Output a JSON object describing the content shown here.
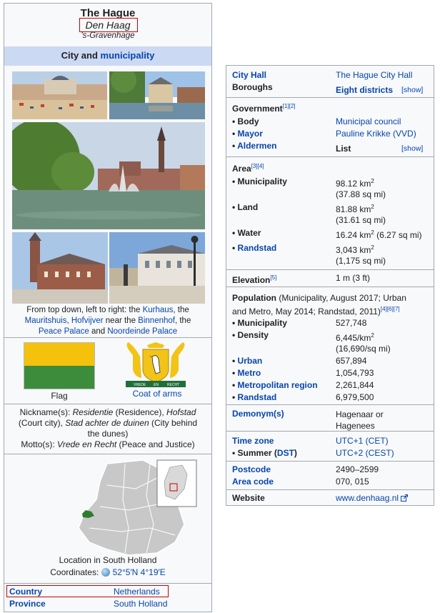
{
  "left": {
    "title": "The Hague",
    "native_name": "Den Haag",
    "other_name": "'s-Gravenhage",
    "header_plain": "City and ",
    "header_link": "municipality",
    "caption_parts": [
      "From top down, left to right: the ",
      "Kurhaus",
      ", the",
      "Mauritshuis",
      ", ",
      "Hofvijver",
      " near the ",
      "Binnenhof",
      ", the",
      "Peace Palace",
      " and ",
      "Noordeinde Palace"
    ],
    "flag_label": "Flag",
    "coat_label": "Coat of arms",
    "coat_scroll": [
      "VREDE",
      "EN",
      "RECHT"
    ],
    "nicknames": {
      "label": "Nickname(s): ",
      "n1": "Residentie",
      "n1_gloss": " (Residence), ",
      "n2": "Hofstad",
      "n2_gloss": "(Court city), ",
      "n3": "Stad achter de duinen",
      "n3_gloss": " (City behind",
      "n3_gloss2": "the dunes)"
    },
    "motto": {
      "label": "Motto(s): ",
      "value": "Vrede en Recht",
      "gloss": " (Peace and Justice)"
    },
    "map_caption": "Location in South Holland",
    "coordinates_label": "Coordinates: ",
    "coordinates_value": "52°5′N 4°19′E",
    "country_label": "Country",
    "country_value": "Netherlands",
    "province_label": "Province",
    "province_value": "South Holland"
  },
  "right": {
    "city_hall_label": "City Hall",
    "city_hall_value": "The Hague City Hall",
    "boroughs_label": "Boroughs",
    "boroughs_value": "Eight districts",
    "show": "[show]",
    "government_label": "Government",
    "government_refs": [
      "[1]",
      "[2]"
    ],
    "body_label": "Body",
    "body_value": "Municipal council",
    "mayor_label": "Mayor",
    "mayor_value": "Pauline Krikke (VVD)",
    "aldermen_label": "Aldermen",
    "aldermen_value": "List",
    "area_label": "Area",
    "area_refs": [
      "[3]",
      "[4]"
    ],
    "area_municipality_label": "Municipality",
    "area_municipality_value": "98.12 km",
    "area_municipality_sqmi": "(37.88 sq mi)",
    "land_label": "Land",
    "land_value": "81.88 km",
    "land_sqmi": "(31.61 sq mi)",
    "water_label": "Water",
    "water_value": "16.24 km",
    "water_sqmi": " (6.27 sq mi)",
    "randstad_area_label": "Randstad",
    "randstad_area_value": "3,043 km",
    "randstad_area_sqmi": "(1,175 sq mi)",
    "sup2": "2",
    "elevation_label": "Elevation",
    "elevation_ref": "[5]",
    "elevation_value": "1 m (3 ft)",
    "population_label": "Population",
    "population_note1": " (Municipality, August 2017; Urban",
    "population_note2": "and Metro, May 2014; Randstad, 2011)",
    "population_refs": [
      "[4]",
      "[6]",
      "[7]"
    ],
    "pop_municipality_label": "Municipality",
    "pop_municipality_value": "527,748",
    "density_label": "Density",
    "density_value": "6,445/km",
    "density_sqmi": "(16,690/sq mi)",
    "urban_label": "Urban",
    "urban_value": "657,894",
    "metro_label": "Metro",
    "metro_value": "1,054,793",
    "metro_region_label": "Metropolitan region",
    "metro_region_value": "2,261,844",
    "randstad_pop_label": "Randstad",
    "randstad_pop_value": "6,979,500",
    "demonym_label": "Demonym(s)",
    "demonym_value1": "Hagenaar or",
    "demonym_value2": "Hagenees",
    "timezone_label": "Time zone",
    "timezone_value": "UTC+1 (CET)",
    "summer_label": "Summer (",
    "summer_dst": "DST",
    "summer_close": ")",
    "summer_value": "UTC+2 (CEST)",
    "postcode_label": "Postcode",
    "postcode_value": "2490–2599",
    "areacode_label": "Area code",
    "areacode_value": "070, 015",
    "website_label": "Website",
    "website_value": "www.denhaag.nl"
  },
  "bullet": "•",
  "colors": {
    "link": "#0645ad",
    "header_bg": "#ccd9f3",
    "border": "#a2a9b1",
    "highlight": "#cc0000",
    "flag_yellow": "#f4c20d",
    "flag_green": "#3c8c3c"
  }
}
